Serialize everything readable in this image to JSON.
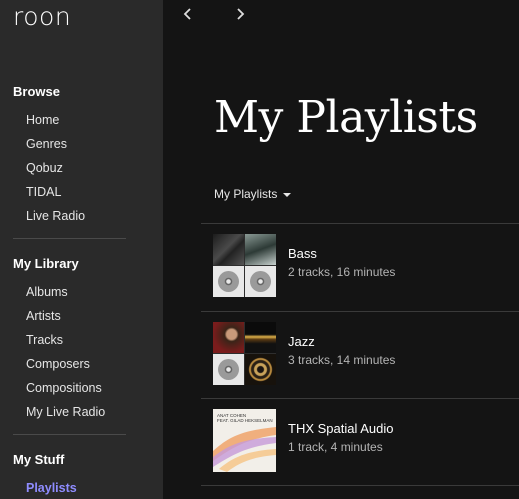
{
  "app": {
    "logo": "roon"
  },
  "sidebar": {
    "browse": {
      "heading": "Browse",
      "items": [
        "Home",
        "Genres",
        "Qobuz",
        "TIDAL",
        "Live Radio"
      ]
    },
    "library": {
      "heading": "My Library",
      "items": [
        "Albums",
        "Artists",
        "Tracks",
        "Composers",
        "Compositions",
        "My Live Radio"
      ]
    },
    "stuff": {
      "heading": "My Stuff",
      "items": [
        "Playlists"
      ],
      "active": "Playlists"
    }
  },
  "header": {
    "back_icon": "chevron-left-icon",
    "forward_icon": "chevron-right-icon"
  },
  "page": {
    "title": "My Playlists",
    "filter_label": "My Playlists"
  },
  "playlists": [
    {
      "name": "Bass",
      "meta": "2 tracks, 16 minutes"
    },
    {
      "name": "Jazz",
      "meta": "3 tracks, 14 minutes"
    },
    {
      "name": "THX Spatial Audio",
      "meta": "1 track, 4 minutes",
      "art_text": [
        "ANAT COHEN",
        "FEAT. GILAD HEKSELMAN"
      ]
    }
  ],
  "colors": {
    "accent": "#8f8cff",
    "sidebar_bg": "#2a2a2a",
    "main_bg": "#141414"
  }
}
